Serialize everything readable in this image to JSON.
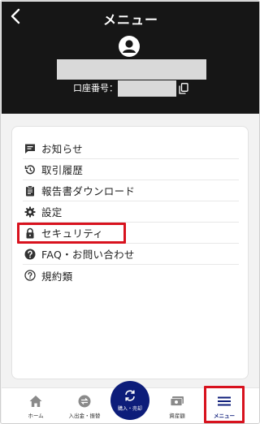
{
  "header": {
    "title": "メニュー",
    "account_label": "口座番号："
  },
  "menu": {
    "items": [
      {
        "label": "お知らせ",
        "icon": "announcement-icon"
      },
      {
        "label": "取引履歴",
        "icon": "history-icon"
      },
      {
        "label": "報告書ダウンロード",
        "icon": "report-icon"
      },
      {
        "label": "設定",
        "icon": "gear-icon"
      },
      {
        "label": "セキュリティ",
        "icon": "lock-icon"
      },
      {
        "label": "FAQ・お問い合わせ",
        "icon": "help-icon"
      },
      {
        "label": "規約類",
        "icon": "terms-icon"
      }
    ]
  },
  "bottom_nav": {
    "items": [
      {
        "label": "ホーム",
        "icon": "home-icon"
      },
      {
        "label": "入出金・振替",
        "icon": "transfer-icon"
      },
      {
        "label": "購入・売却",
        "icon": "trade-icon"
      },
      {
        "label": "資産額",
        "icon": "assets-icon"
      },
      {
        "label": "メニュー",
        "icon": "menu-icon"
      }
    ]
  },
  "colors": {
    "header_bg": "#161616",
    "accent_navy": "#0d1d7a",
    "highlight_red": "#d8121e",
    "redacted_gray": "#d9d9d9"
  }
}
